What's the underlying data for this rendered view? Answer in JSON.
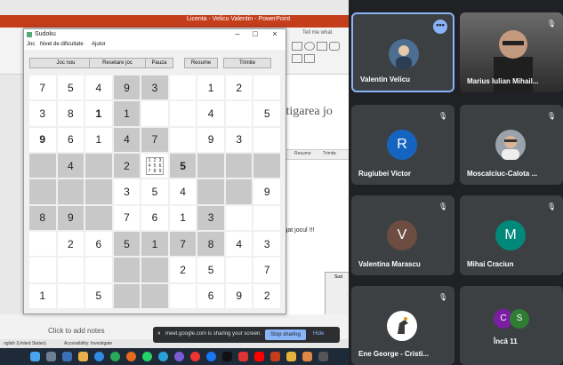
{
  "powerpoint": {
    "title": "Licenta - Velicu Valentin - PowerPoint",
    "tell_me": "Tell me what",
    "slide_title": "stigarea jo",
    "slide_text": "tigat jocul !!!",
    "slide_window_labels": [
      "Resume",
      "Trimite"
    ],
    "notes_placeholder": "Click to add notes",
    "status_language": "nglish (United States)",
    "status_accessibility": "Accessibility: Investigate",
    "mini_window_title": "Sud"
  },
  "screen_share": {
    "message": "meet.google.com is sharing your screen.",
    "stop_label": "Stop sharing",
    "hide_label": "Hide"
  },
  "sudoku": {
    "window_title": "Sudoku",
    "menu": [
      "Joc",
      "Nivel de dificultate",
      "Ajutor"
    ],
    "buttons": [
      "Joc nou",
      "Resetare joc",
      "Pauza",
      "Resume",
      "Trimite"
    ],
    "cells": [
      [
        "7",
        "5",
        "4",
        "9",
        "3",
        "",
        "1",
        "2",
        ""
      ],
      [
        "3",
        "8",
        "1",
        "1",
        "",
        "",
        "4",
        "",
        "5"
      ],
      [
        "9",
        "6",
        "1",
        "4",
        "7",
        "",
        "9",
        "3",
        ""
      ],
      [
        "",
        "4",
        "",
        "2",
        "NOTES",
        "5",
        "",
        "",
        ""
      ],
      [
        "",
        "",
        "",
        "3",
        "5",
        "4",
        "",
        "",
        "9"
      ],
      [
        "8",
        "9",
        "",
        "7",
        "6",
        "1",
        "3",
        "",
        ""
      ],
      [
        "",
        "2",
        "6",
        "5",
        "1",
        "7",
        "8",
        "4",
        "3"
      ],
      [
        "",
        "",
        "",
        "",
        "",
        "2",
        "5",
        "",
        "7"
      ],
      [
        "1",
        "",
        "5",
        "",
        "",
        "",
        "6",
        "9",
        "2"
      ]
    ],
    "shade": [
      "wwwggwwww",
      "wwwgwwwww",
      "wwwggwwww",
      "ggggwgggg",
      "gggwwwggw",
      "gggwwwgww",
      "wwwggggww",
      "wwwggwwww",
      "wwwggwwww"
    ],
    "bold_cells": [
      "1,2",
      "2,0",
      "3,5"
    ],
    "note_digits": [
      "1",
      "2",
      "3",
      "4",
      "5",
      "6",
      "7",
      "8",
      "9"
    ]
  },
  "meet": {
    "participants": [
      {
        "name": "Valentin Velicu",
        "type": "photo",
        "active": true,
        "more": "•••"
      },
      {
        "name": "Marius Iulian Mihail...",
        "type": "video",
        "muted": true
      },
      {
        "name": "Rugiubei Victor",
        "type": "initial",
        "initial": "R",
        "color": "#1565c0",
        "muted": true
      },
      {
        "name": "Moscalciuc-Calota ...",
        "type": "photo",
        "muted": true
      },
      {
        "name": "Valentina Marascu",
        "type": "initial",
        "initial": "V",
        "color": "#6d4c41",
        "muted": true
      },
      {
        "name": "Mihai Craciun",
        "type": "initial",
        "initial": "M",
        "color": "#00897b",
        "muted": true
      },
      {
        "name": "Ene George - Cristi...",
        "type": "photo",
        "muted": true
      },
      {
        "name": "Încă 11",
        "type": "more",
        "initials": [
          "C",
          "S"
        ],
        "colors": [
          "#7b1fa2",
          "#2e7d32"
        ]
      }
    ]
  }
}
